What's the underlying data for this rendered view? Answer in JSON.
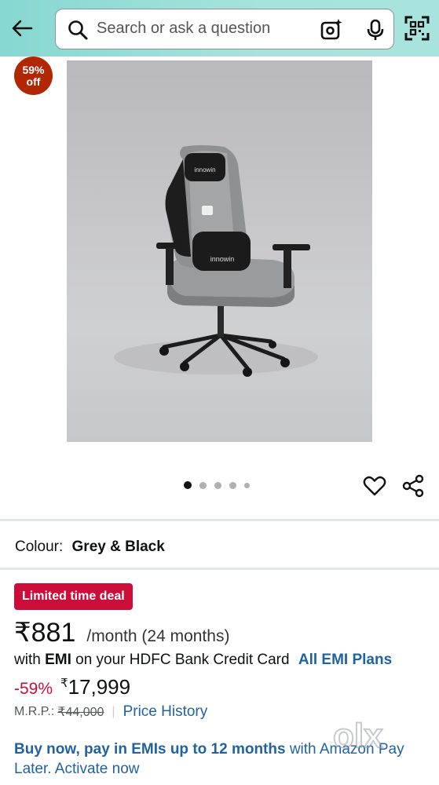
{
  "header": {
    "search_placeholder": "Search or ask a question"
  },
  "product": {
    "discount_badge_pct": "59%",
    "discount_badge_off": "off",
    "image_brand_text": "innowin",
    "image_count": 5,
    "active_image_index": 0
  },
  "colour": {
    "label": "Colour:",
    "value": "Grey & Black"
  },
  "deal": {
    "badge": "Limited time deal",
    "emi_price": "₹881",
    "emi_period": "/month (24 months)",
    "emi_with": "with",
    "emi_word": "EMI",
    "emi_card": "on your HDFC Bank Credit Card",
    "emi_plans_link": "All EMI Plans",
    "discount_pct": "-59%",
    "currency_symbol": "₹",
    "price": "17,999",
    "mrp_label": "M.R.P.:",
    "mrp_value": "₹44,000",
    "price_history_link": "Price History"
  },
  "pay_later": {
    "bold_text": "Buy now, pay in EMIs up to 12 months",
    "text": " with Amazon Pay Later. Activate now"
  },
  "watermark": "olx",
  "colors": {
    "header_bg": "#a6e3dc",
    "badge_red": "#b12704",
    "deal_red": "#cc0c39",
    "link_blue": "#2162a1"
  }
}
